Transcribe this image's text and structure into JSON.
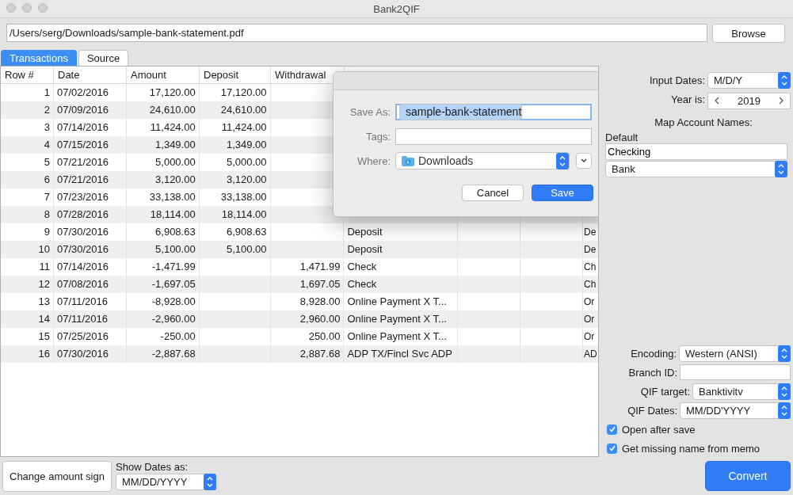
{
  "window": {
    "title": "Bank2QIF"
  },
  "file_path": {
    "value": "/Users/serg/Downloads/sample-bank-statement.pdf"
  },
  "browse_button": "Browse",
  "tabs": [
    {
      "label": "Transactions",
      "selected": true
    },
    {
      "label": "Source",
      "selected": false
    }
  ],
  "table": {
    "columns": [
      "Row #",
      "Date",
      "Amount",
      "Deposit",
      "Withdrawal"
    ],
    "rows": [
      {
        "row": "1",
        "date": "07/02/2016",
        "amount": "17,120.00",
        "deposit": "17,120.00"
      },
      {
        "row": "2",
        "date": "07/09/2016",
        "amount": "24,610.00",
        "deposit": "24,610.00"
      },
      {
        "row": "3",
        "date": "07/14/2016",
        "amount": "11,424.00",
        "deposit": "11,424.00"
      },
      {
        "row": "4",
        "date": "07/15/2016",
        "amount": "1,349.00",
        "deposit": "1,349.00"
      },
      {
        "row": "5",
        "date": "07/21/2016",
        "amount": "5,000.00",
        "deposit": "5,000.00"
      },
      {
        "row": "6",
        "date": "07/21/2016",
        "amount": "3,120.00",
        "deposit": "3,120.00"
      },
      {
        "row": "7",
        "date": "07/23/2016",
        "amount": "33,138.00",
        "deposit": "33,138.00"
      },
      {
        "row": "8",
        "date": "07/28/2016",
        "amount": "18,114.00",
        "deposit": "18,114.00"
      },
      {
        "row": "9",
        "date": "07/30/2016",
        "amount": "6,908.63",
        "deposit": "6,908.63",
        "column_6": "Deposit",
        "column_9": "De"
      },
      {
        "row": "10",
        "date": "07/30/2016",
        "amount": "5,100.00",
        "deposit": "5,100.00",
        "column_6": "Deposit",
        "column_9": "De"
      },
      {
        "row": "11",
        "date": "07/14/2016",
        "amount": "-1,471.99",
        "withdrawal": "1,471.99",
        "column_6": "Check",
        "column_9": "Ch"
      },
      {
        "row": "12",
        "date": "07/08/2016",
        "amount": "-1,697.05",
        "withdrawal": "1,697.05",
        "column_6": "Check",
        "column_9": "Ch"
      },
      {
        "row": "13",
        "date": "07/11/2016",
        "amount": "-8,928.00",
        "withdrawal": "8,928.00",
        "column_6": "Online Payment X T...",
        "column_9": "Or"
      },
      {
        "row": "14",
        "date": "07/11/2016",
        "amount": "-2,960.00",
        "withdrawal": "2,960.00",
        "column_6": "Online Payment X T...",
        "column_9": "Or"
      },
      {
        "row": "15",
        "date": "07/25/2016",
        "amount": "-250.00",
        "withdrawal": "250.00",
        "column_6": "Online Payment X T...",
        "column_9": "Or"
      },
      {
        "row": "16",
        "date": "07/30/2016",
        "amount": "-2,887.68",
        "withdrawal": "2,887.68",
        "column_6": "ADP TX/Fincl Svc ADP",
        "column_9": "AD"
      }
    ]
  },
  "save_dialog": {
    "save_as_label": "Save As:",
    "save_as_value": "sample-bank-statement",
    "save_as_selected": true,
    "tags_label": "Tags:",
    "where_label": "Where:",
    "where_value": "Downloads",
    "buttons": [
      {
        "label": "Cancel",
        "default": false
      },
      {
        "label": "Save",
        "default": true
      }
    ]
  },
  "settings": {
    "input_dates": {
      "label": "Input Dates:",
      "value": "M/D/Y"
    },
    "year": {
      "label": "Year is:",
      "value": "2019"
    },
    "map_title": "Map Account Names:",
    "default_label": "Default",
    "account_name": "Checking",
    "account_type": "Bank",
    "encoding": {
      "label": "Encoding:",
      "value": "Western (ANSI)"
    },
    "branch_id": {
      "label": "Branch ID:"
    },
    "qif_target": {
      "label": "QIF target:",
      "value": "Banktivitv"
    },
    "qif_dates": {
      "label": "QIF Dates:",
      "value": "MM/DD'YYYY"
    },
    "checkboxes": [
      {
        "label": "Open after save",
        "checked": true
      },
      {
        "label": "Get missing name from memo",
        "checked": true
      }
    ],
    "convert_button": "Convert"
  },
  "bottom": {
    "change_sign_button": "Change amount sign",
    "show_dates_label": "Show Dates as:",
    "show_dates_value": "MM/DD/YYYY"
  }
}
